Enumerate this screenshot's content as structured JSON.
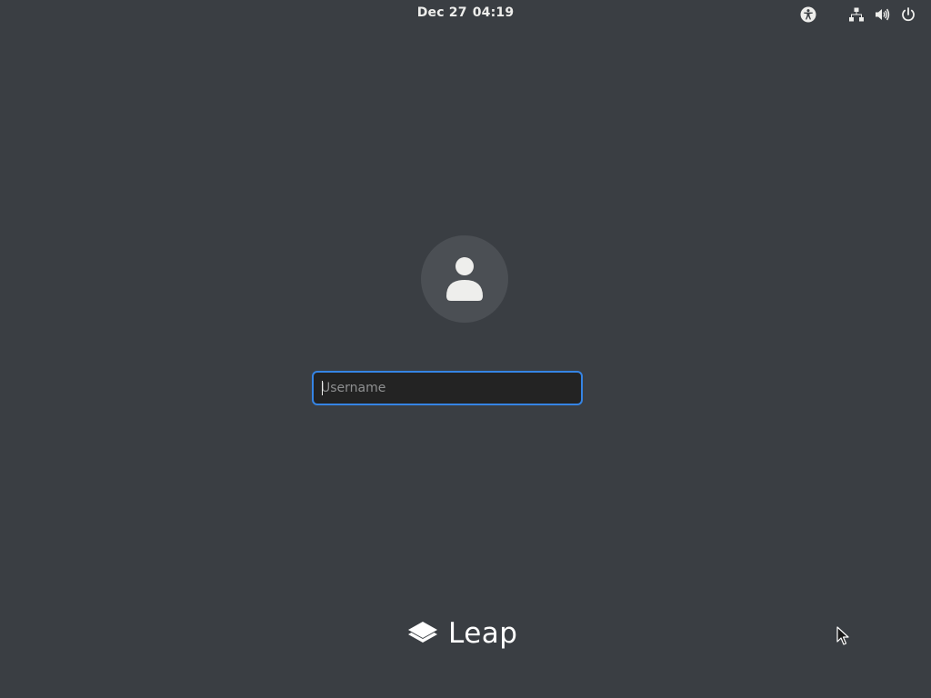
{
  "topbar": {
    "date": "Dec 27",
    "time": "04:19",
    "icons": [
      "accessibility-icon",
      "network-wired-icon",
      "volume-icon",
      "power-icon"
    ]
  },
  "login": {
    "avatar_icon": "user-icon",
    "username_placeholder": "Username",
    "username_value": ""
  },
  "branding": {
    "logo_icon": "layers-icon",
    "logo_text": "Leap"
  },
  "colors": {
    "background": "#3a3e43",
    "accent": "#3584e4",
    "input_bg": "#232323",
    "avatar_bg": "#4b4f54",
    "text": "#eeeeec"
  }
}
